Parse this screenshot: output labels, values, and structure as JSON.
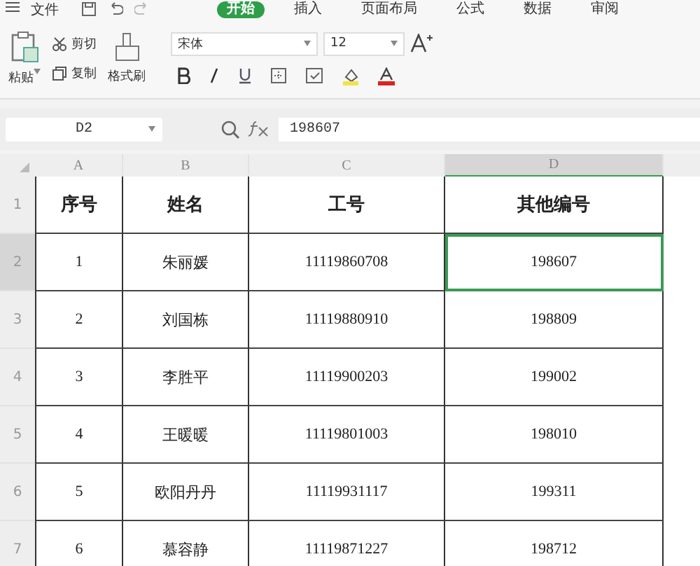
{
  "menu": {
    "file_label": "文件"
  },
  "ribbon_tabs": [
    {
      "label": "开始",
      "selected": true
    },
    {
      "label": "插入",
      "selected": false
    },
    {
      "label": "页面布局",
      "selected": false
    },
    {
      "label": "公式",
      "selected": false
    },
    {
      "label": "数据",
      "selected": false
    },
    {
      "label": "审阅",
      "selected": false
    }
  ],
  "clipboard": {
    "paste": "粘贴",
    "cut": "剪切",
    "copy": "复制",
    "format_painter": "格式刷"
  },
  "font": {
    "family": "宋体",
    "size": "12"
  },
  "formula_bar": {
    "name_box": "D2",
    "formula": "198607"
  },
  "columns": [
    {
      "label": "A",
      "selected": false
    },
    {
      "label": "B",
      "selected": false
    },
    {
      "label": "C",
      "selected": false
    },
    {
      "label": "D",
      "selected": true
    }
  ],
  "rows": [
    {
      "label": "1",
      "selected": false,
      "header": true,
      "cells": [
        "序号",
        "姓名",
        "工号",
        "其他编号"
      ]
    },
    {
      "label": "2",
      "selected": true,
      "header": false,
      "cells": [
        "1",
        "朱丽媛",
        "11119860708",
        "198607"
      ]
    },
    {
      "label": "3",
      "selected": false,
      "header": false,
      "cells": [
        "2",
        "刘国栋",
        "11119880910",
        "198809"
      ]
    },
    {
      "label": "4",
      "selected": false,
      "header": false,
      "cells": [
        "3",
        "李胜平",
        "11119900203",
        "199002"
      ]
    },
    {
      "label": "5",
      "selected": false,
      "header": false,
      "cells": [
        "4",
        "王暖暖",
        "11119801003",
        "198010"
      ]
    },
    {
      "label": "6",
      "selected": false,
      "header": false,
      "cells": [
        "5",
        "欧阳丹丹",
        "11119931117",
        "199311"
      ]
    },
    {
      "label": "7",
      "selected": false,
      "header": false,
      "cells": [
        "6",
        "慕容静",
        "11119871227",
        "198712"
      ]
    }
  ]
}
